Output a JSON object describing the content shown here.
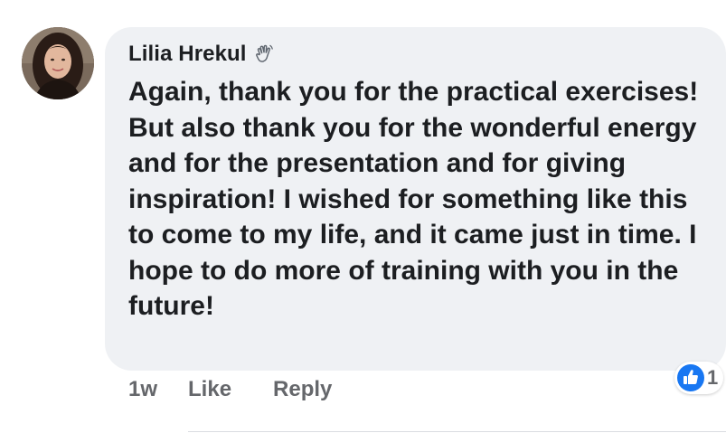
{
  "comment": {
    "author": "Lilia Hrekul",
    "badge_icon": "wave-hand-icon",
    "text": "Again, thank you for the practical exercises! But also thank you for the wonderful energy and for the presentation and for giving inspiration! I wished for something like this to come to my life, and it came just in time. I hope to do more of training with you in the future!",
    "timestamp": "1w",
    "like_label": "Like",
    "reply_label": "Reply",
    "reaction": {
      "icon": "thumbs-up-icon",
      "count": "1",
      "color": "#1877f2"
    }
  },
  "colors": {
    "bubble": "#eff1f4",
    "text": "#1c1e21",
    "secondary_text": "#65676b"
  }
}
